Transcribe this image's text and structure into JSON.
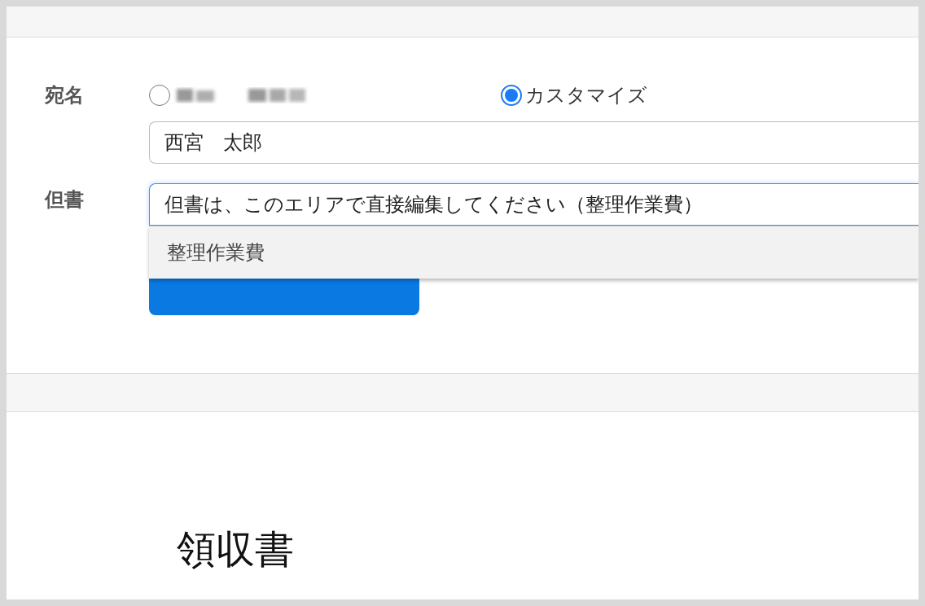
{
  "recipient": {
    "label": "宛名",
    "options": [
      {
        "kind": "redacted",
        "selected": false
      },
      {
        "kind": "text",
        "label": "カスタマイズ",
        "selected": true
      }
    ],
    "name_field": {
      "value": "西宮　太郎"
    }
  },
  "proviso": {
    "label": "但書",
    "field": {
      "value": "但書は、このエリアで直接編集してください（整理作業費）",
      "focused": true
    },
    "suggestions": [
      {
        "label": "整理作業費"
      }
    ]
  },
  "receipt": {
    "title": "領収書"
  }
}
